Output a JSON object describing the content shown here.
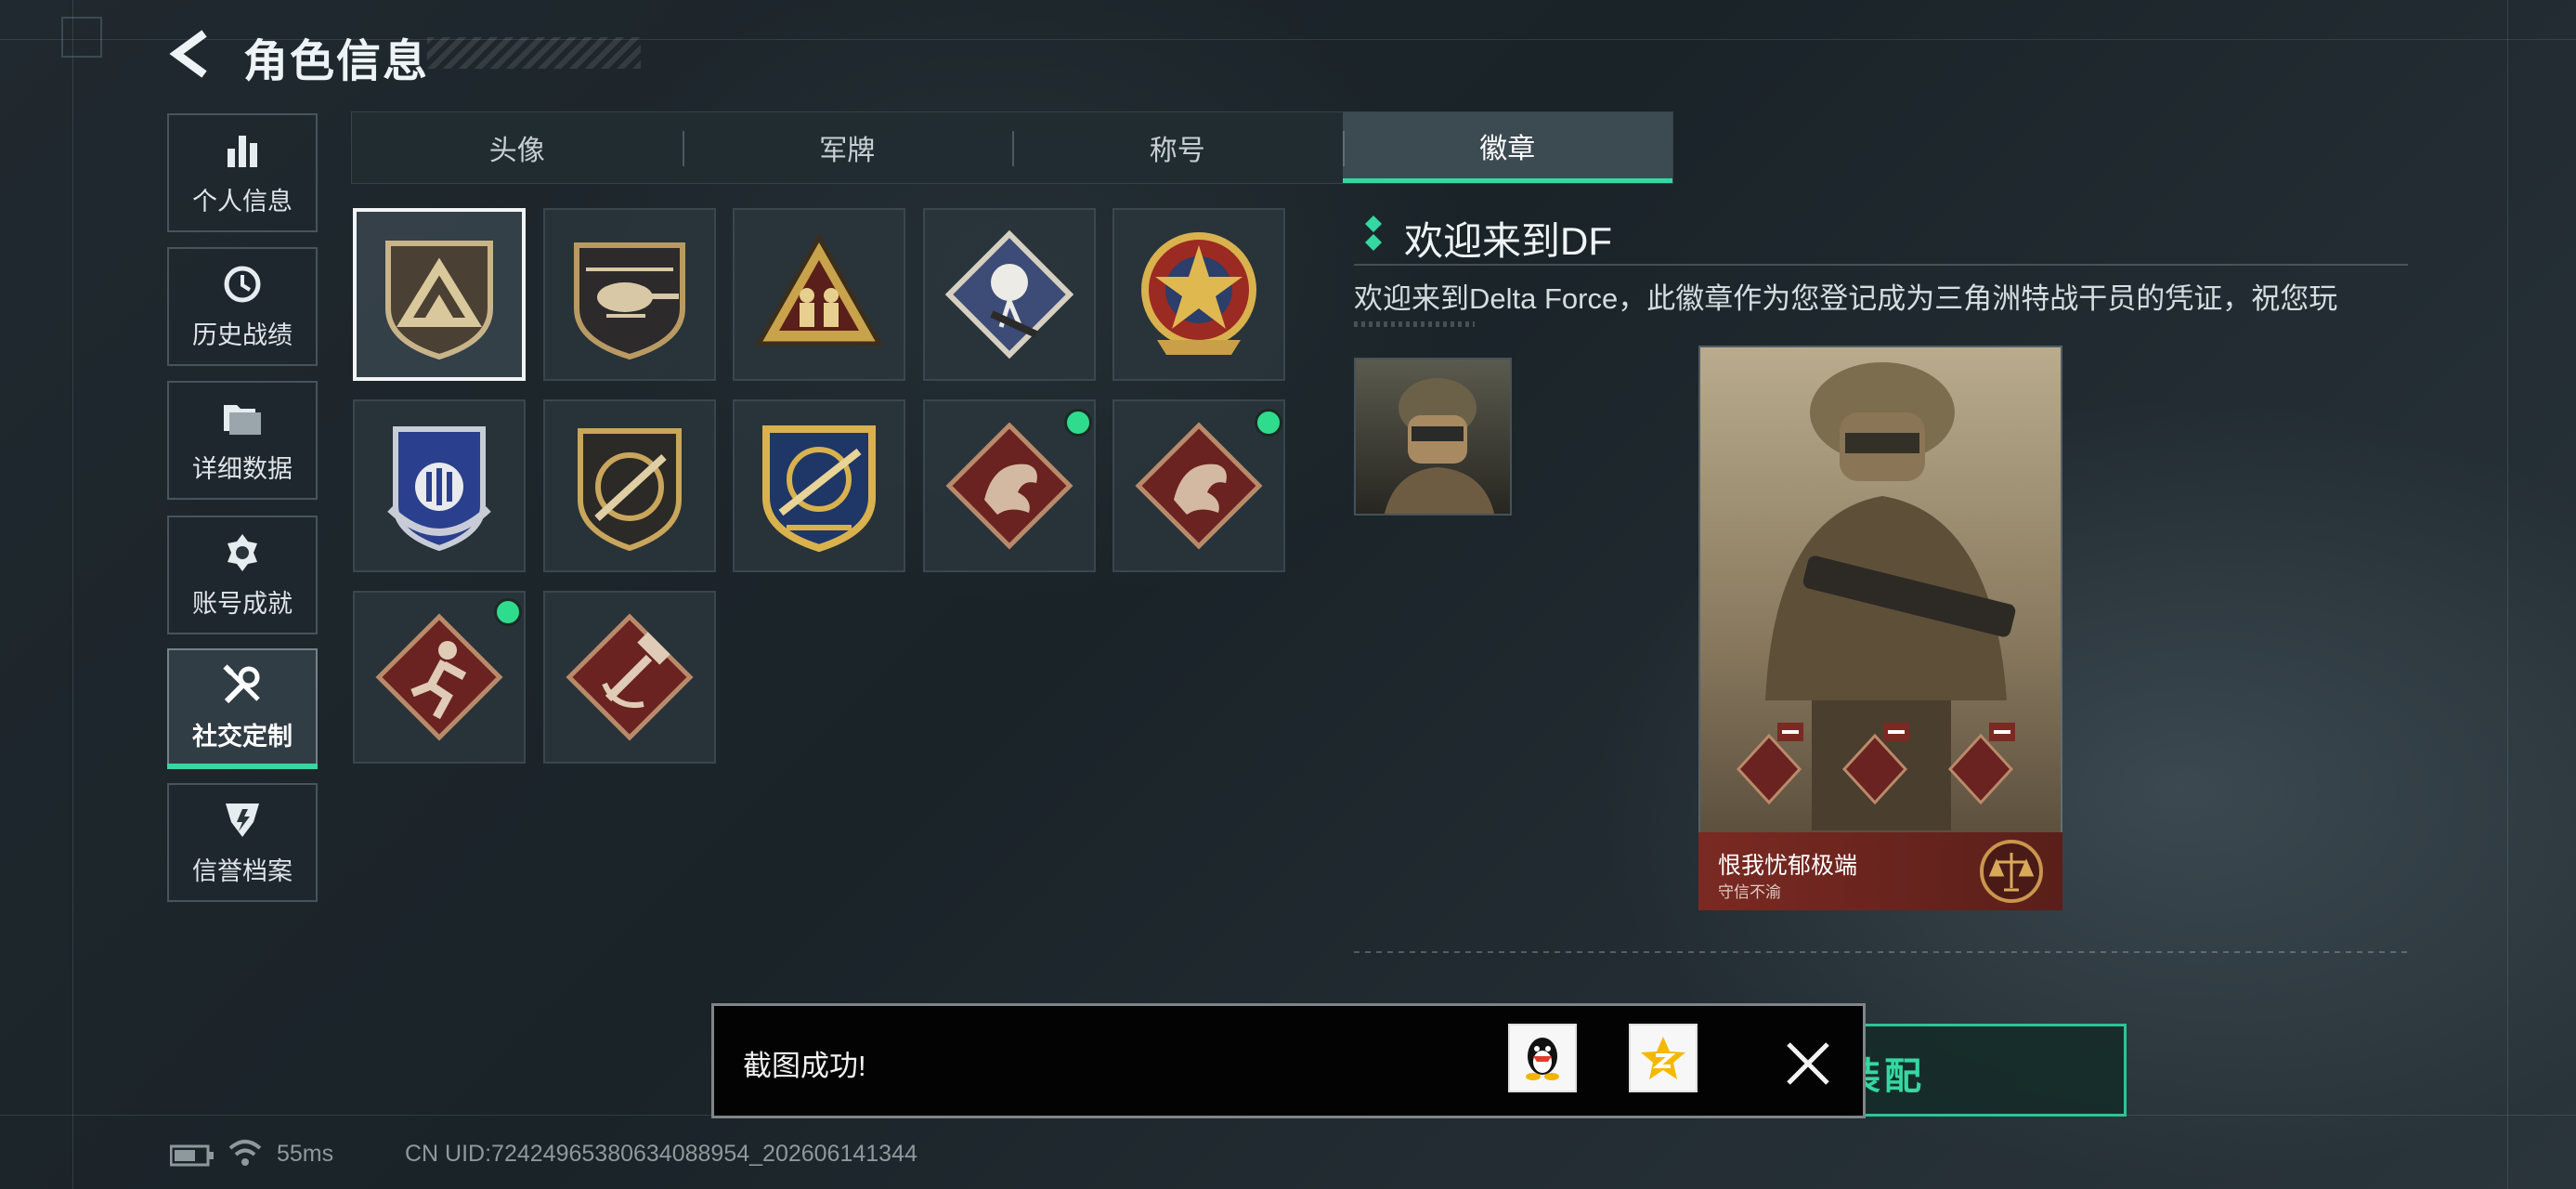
{
  "header": {
    "title": "角色信息"
  },
  "sidebar": {
    "items": [
      {
        "label": "个人信息",
        "icon": "bar-chart-icon"
      },
      {
        "label": "历史战绩",
        "icon": "clock-history-icon"
      },
      {
        "label": "详细数据",
        "icon": "folder-icon"
      },
      {
        "label": "账号成就",
        "icon": "achievement-medal-icon"
      },
      {
        "label": "社交定制",
        "icon": "wrench-screwdriver-icon",
        "active": true
      },
      {
        "label": "信誉档案",
        "icon": "credit-shield-icon"
      }
    ]
  },
  "tabs": [
    {
      "label": "头像"
    },
    {
      "label": "军牌"
    },
    {
      "label": "称号"
    },
    {
      "label": "徽章",
      "active": true
    }
  ],
  "badges": [
    {
      "icon": "delta-triangle-badge-icon",
      "selected": true
    },
    {
      "icon": "helicopter-badge-icon"
    },
    {
      "icon": "soldiers-triangle-badge-icon"
    },
    {
      "icon": "rose-badge-icon"
    },
    {
      "icon": "star-ring-badge-icon"
    },
    {
      "icon": "blue-wings-badge-icon"
    },
    {
      "icon": "rifle-target-badge-icon"
    },
    {
      "icon": "sniper-scope-badge-icon"
    },
    {
      "icon": "dragon-badge-icon",
      "new": true
    },
    {
      "icon": "dragon-badge-icon",
      "new": true
    },
    {
      "icon": "runner-badge-icon",
      "new": true
    },
    {
      "icon": "hammer-badge-icon"
    }
  ],
  "detail": {
    "title": "欢迎来到DF",
    "description": "欢迎来到Delta Force，此徽章作为您登记成为三角洲特战干员的凭证，祝您玩"
  },
  "card": {
    "name": "恨我忧郁极端",
    "subtitle": "守信不渝"
  },
  "equip_button": {
    "label": "装配"
  },
  "toast": {
    "message": "截图成功!",
    "share_icons": [
      "qq-penguin-icon",
      "qzone-star-icon"
    ]
  },
  "status_bar": {
    "ping": "55ms",
    "uid": "CN UID:7242496538063408895­4_202606141344"
  },
  "colors": {
    "accent": "#34d8a0",
    "toast_bg": "#030303",
    "card_banner": "#7a2a22"
  }
}
